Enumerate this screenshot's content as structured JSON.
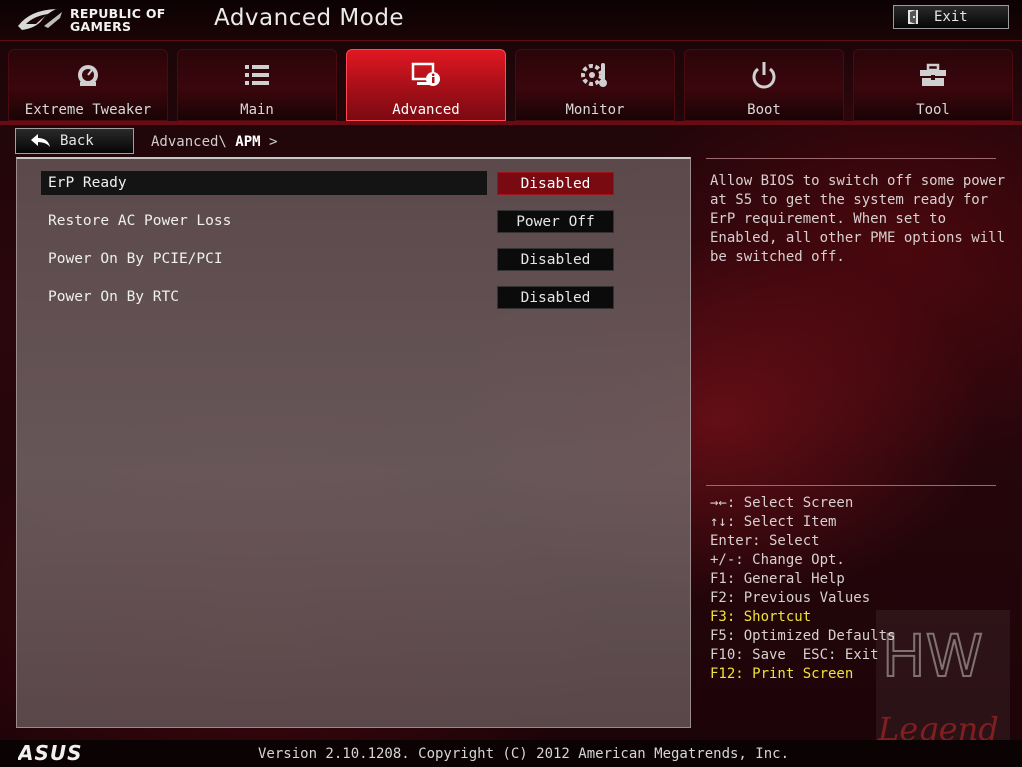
{
  "header": {
    "brand_line1": "REPUBLIC OF",
    "brand_line2": "GAMERS",
    "mode_title": "Advanced Mode",
    "exit_label": "Exit"
  },
  "tabs": [
    {
      "label": "Extreme Tweaker",
      "icon": "meter-icon",
      "active": false
    },
    {
      "label": "Main",
      "icon": "list-icon",
      "active": false
    },
    {
      "label": "Advanced",
      "icon": "info-icon",
      "active": true
    },
    {
      "label": "Monitor",
      "icon": "monitor-gear-icon",
      "active": false
    },
    {
      "label": "Boot",
      "icon": "power-icon",
      "active": false
    },
    {
      "label": "Tool",
      "icon": "toolbox-icon",
      "active": false
    }
  ],
  "nav": {
    "back_label": "Back",
    "breadcrumb_parent": "Advanced\\",
    "breadcrumb_current": "APM",
    "breadcrumb_arrow": ">"
  },
  "settings": [
    {
      "name": "ErP Ready",
      "value": "Disabled",
      "selected": true
    },
    {
      "name": "Restore AC Power Loss",
      "value": "Power Off",
      "selected": false
    },
    {
      "name": "Power On By PCIE/PCI",
      "value": "Disabled",
      "selected": false
    },
    {
      "name": "Power On By RTC",
      "value": "Disabled",
      "selected": false
    }
  ],
  "help": {
    "description": "Allow BIOS to switch off some power at S5 to get the system ready for ErP requirement. When set to Enabled, all other PME options will be switched off."
  },
  "keys": [
    {
      "text": "→←: Select Screen",
      "highlight": false
    },
    {
      "text": "↑↓: Select Item",
      "highlight": false
    },
    {
      "text": "Enter: Select",
      "highlight": false
    },
    {
      "text": "+/-: Change Opt.",
      "highlight": false
    },
    {
      "text": "F1: General Help",
      "highlight": false
    },
    {
      "text": "F2: Previous Values",
      "highlight": false
    },
    {
      "text": "F3: Shortcut",
      "highlight": true
    },
    {
      "text": "F5: Optimized Defaults",
      "highlight": false
    },
    {
      "text": "F10: Save  ESC: Exit",
      "highlight": false
    },
    {
      "text": "F12: Print Screen",
      "highlight": true
    }
  ],
  "footer": {
    "brand": "ASUS",
    "version": "Version 2.10.1208. Copyright (C) 2012 American Megatrends, Inc."
  },
  "watermark": {
    "text_top": "HW",
    "text_bottom": "Legend"
  },
  "colors": {
    "accent_red": "#b0101a",
    "selected_value_bg": "#7a0a12",
    "highlight_yellow": "#f2e23a"
  }
}
